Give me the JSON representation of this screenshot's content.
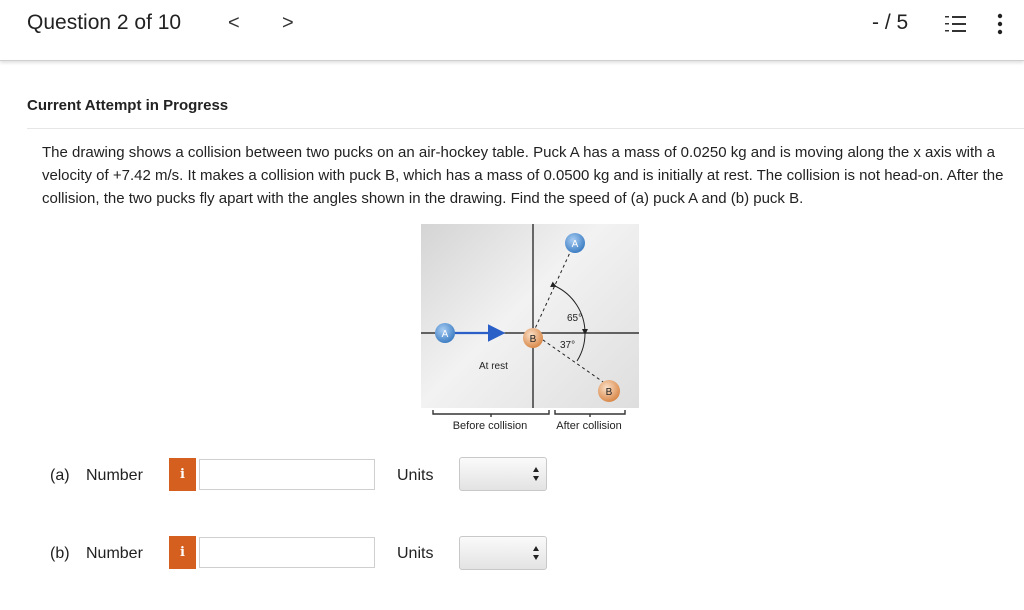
{
  "header": {
    "question_title": "Question 2 of 10",
    "prev_label": "<",
    "next_label": ">",
    "score": "- / 5"
  },
  "attempt_label": "Current Attempt in Progress",
  "problem_text": "The drawing shows a collision between two pucks on an air-hockey table. Puck A has a mass of 0.0250 kg and is moving along the x axis with a velocity of +7.42 m/s. It makes a collision with puck B, which has a mass of 0.0500 kg and is initially at rest. The collision is not head-on. After the collision, the two pucks fly apart with the angles shown in the drawing. Find the speed of (a) puck A and (b) puck B.",
  "figure": {
    "puck_a_label": "A",
    "puck_b_label": "B",
    "angle_a": "65°",
    "angle_b": "37°",
    "at_rest_label": "At rest",
    "before_label": "Before collision",
    "after_label": "After collision"
  },
  "parts": [
    {
      "label": "(a)",
      "field_label": "Number",
      "value": "",
      "units_label": "Units",
      "units_value": ""
    },
    {
      "label": "(b)",
      "field_label": "Number",
      "value": "",
      "units_label": "Units",
      "units_value": ""
    }
  ],
  "info_icon_glyph": "i",
  "colors": {
    "info_button": "#d45f1e",
    "puck_a": "#3f7fc4",
    "puck_b": "#d9894a",
    "arrow": "#2a5fc8"
  },
  "icons": [
    "list-icon",
    "kebab-menu-icon",
    "info-icon",
    "select-arrows-icon"
  ]
}
